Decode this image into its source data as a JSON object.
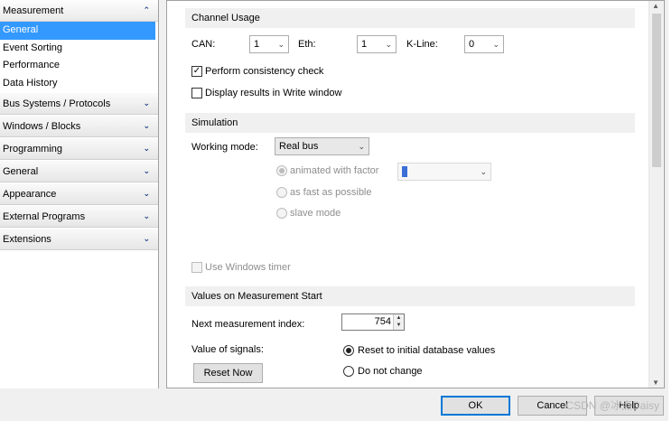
{
  "nav": {
    "header": "Measurement",
    "header_chevron": "⌃",
    "sub_items": [
      {
        "label": "General"
      },
      {
        "label": "Event Sorting"
      },
      {
        "label": "Performance"
      },
      {
        "label": "Data History"
      }
    ],
    "groups": [
      {
        "label": "Bus Systems / Protocols"
      },
      {
        "label": "Windows / Blocks"
      },
      {
        "label": "Programming"
      },
      {
        "label": "General"
      },
      {
        "label": "Appearance"
      },
      {
        "label": "External Programs"
      },
      {
        "label": "Extensions"
      }
    ],
    "group_chevron": "⌄"
  },
  "channel_usage": {
    "title": "Channel Usage",
    "can_label": "CAN:",
    "can_value": "1",
    "eth_label": "Eth:",
    "eth_value": "1",
    "kline_label": "K-Line:",
    "kline_value": "0",
    "consistency_label": "Perform consistency check",
    "consistency_checked": true,
    "write_window_label": "Display results in Write window",
    "write_window_checked": false
  },
  "simulation": {
    "title": "Simulation",
    "working_mode_label": "Working mode:",
    "working_mode_value": "Real bus",
    "animated_label": "animated with factor",
    "fast_label": "as fast as possible",
    "slave_label": "slave mode",
    "windows_timer_label": "Use Windows timer"
  },
  "measurement_start": {
    "title": "Values on Measurement Start",
    "next_index_label": "Next measurement index:",
    "next_index_value": "754",
    "value_signals_label": "Value of signals:",
    "reset_initial_label": "Reset to initial database values",
    "do_not_change_label": "Do not change",
    "reset_now_label": "Reset Now"
  },
  "footer": {
    "ok_label": "OK",
    "cancel_label": "Cancel",
    "help_label": "Help",
    "watermark": "CSDN @冰点Daisy"
  },
  "icons": {
    "dropdown": "⌄",
    "check": "✓",
    "spin_up": "▲",
    "spin_down": "▼",
    "scroll_up": "▲",
    "scroll_down": "▼"
  }
}
